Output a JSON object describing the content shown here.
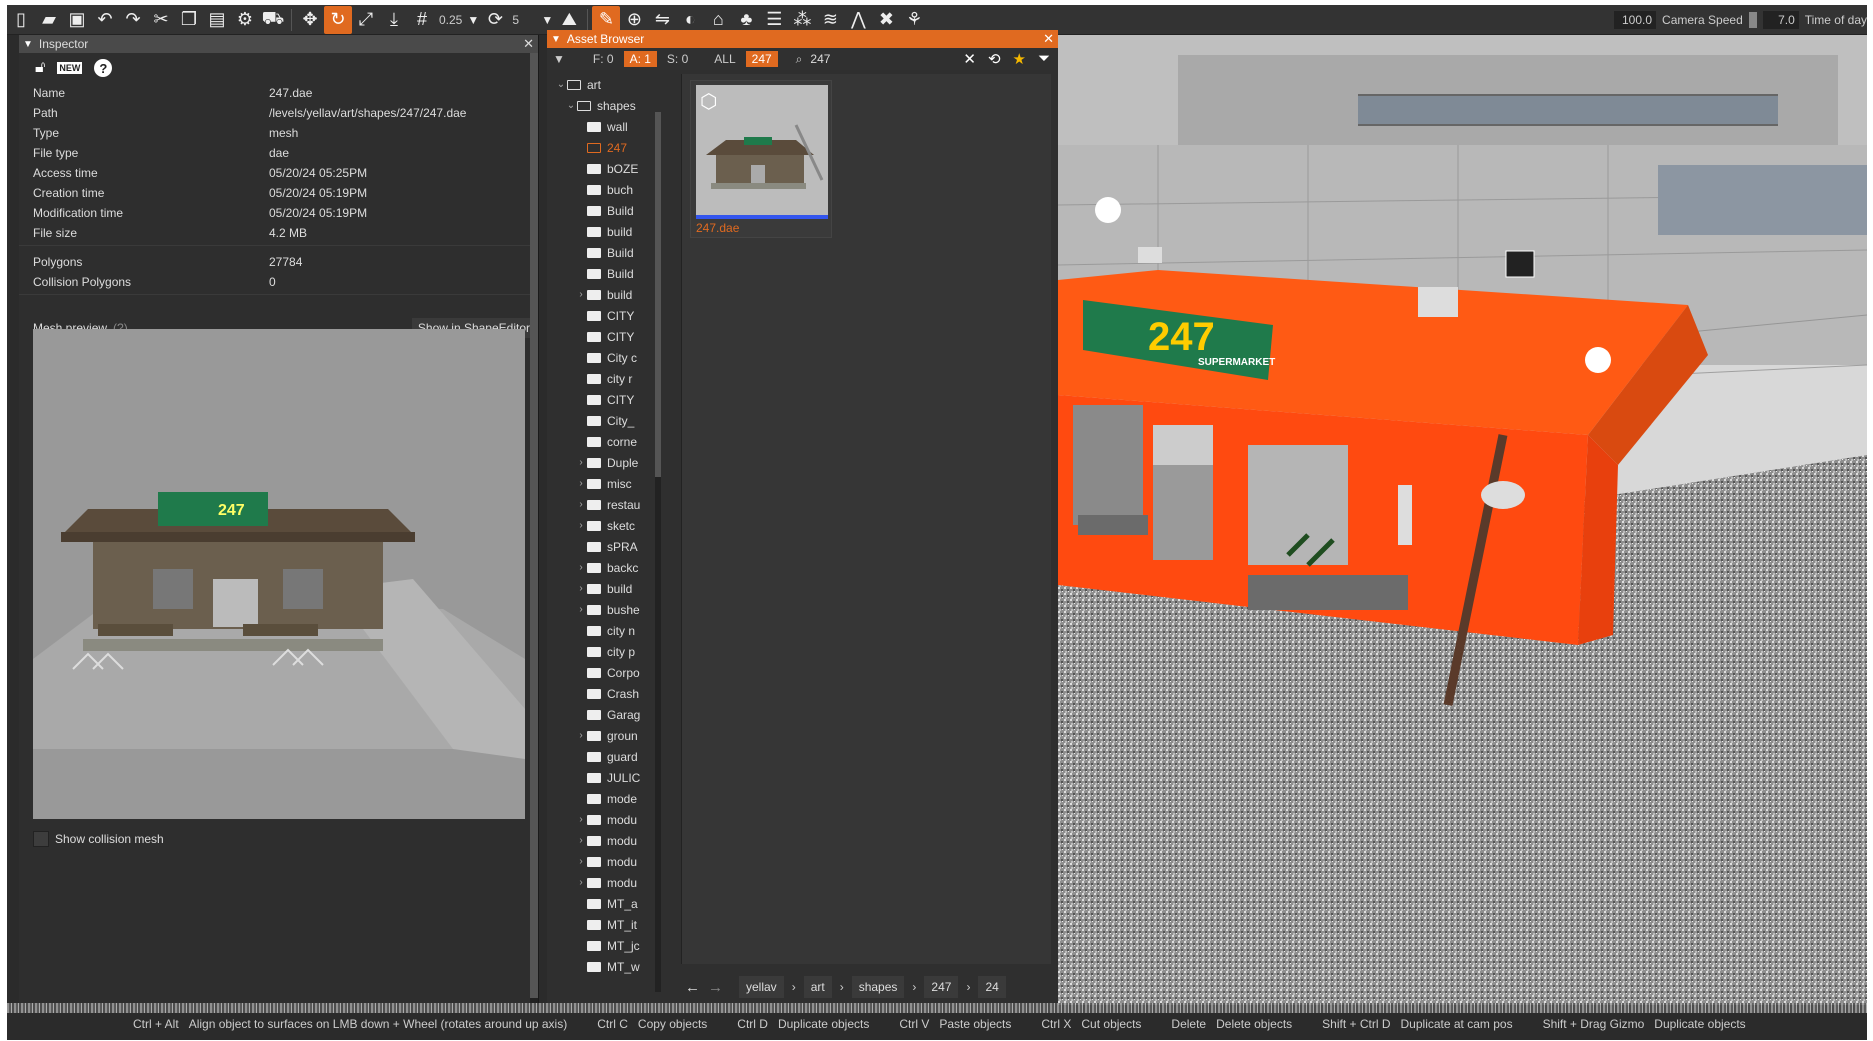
{
  "toolbar": {
    "snap_value": "0.25",
    "rotate_value": "5",
    "camera_speed_value": "100.0",
    "camera_speed_label": "Camera Speed",
    "time_value": "7.0",
    "time_label": "Time of day",
    "active_tool_color": "#e06a20"
  },
  "inspector": {
    "title": "Inspector",
    "tools": [
      "lock-icon",
      "new-icon",
      "help-icon"
    ],
    "new_label": "NEW",
    "props": [
      {
        "k": "Name",
        "v": "247.dae"
      },
      {
        "k": "Path",
        "v": "/levels/yellav/art/shapes/247/247.dae"
      },
      {
        "k": "Type",
        "v": "mesh"
      },
      {
        "k": "File type",
        "v": "dae"
      },
      {
        "k": "Access time",
        "v": "05/20/24 05:25PM"
      },
      {
        "k": "Creation time",
        "v": "05/20/24 05:19PM"
      },
      {
        "k": "Modification time",
        "v": "05/20/24 05:19PM"
      },
      {
        "k": "File size",
        "v": "4.2 MB"
      }
    ],
    "mesh_props": [
      {
        "k": "Polygons",
        "v": "27784"
      },
      {
        "k": "Collision Polygons",
        "v": "0"
      }
    ],
    "mesh_preview_label": "Mesh preview",
    "help_mark": "(?)",
    "show_in_shape_editor": "Show in ShapeEditor",
    "show_collision_mesh": "Show collision mesh"
  },
  "asset_browser": {
    "title": "Asset Browser",
    "filters": {
      "f": "F: 0",
      "a": "A: 1",
      "s": "S: 0",
      "all": "ALL",
      "tag": "247"
    },
    "search_value": "247",
    "tree": [
      {
        "label": "art",
        "indent": 0,
        "arrow": "⌄",
        "fold": "open"
      },
      {
        "label": "shapes",
        "indent": 1,
        "arrow": "⌄",
        "fold": "open"
      },
      {
        "label": "wall",
        "indent": 2,
        "arrow": "",
        "fold": "solid"
      },
      {
        "label": "247",
        "indent": 2,
        "arrow": "",
        "fold": "sel",
        "sel": true
      },
      {
        "label": "bOZE",
        "indent": 2,
        "arrow": "",
        "fold": "solid"
      },
      {
        "label": "buch",
        "indent": 2,
        "arrow": "",
        "fold": "solid"
      },
      {
        "label": "Build",
        "indent": 2,
        "arrow": "",
        "fold": "solid"
      },
      {
        "label": "build",
        "indent": 2,
        "arrow": "",
        "fold": "solid"
      },
      {
        "label": "Build",
        "indent": 2,
        "arrow": "",
        "fold": "solid"
      },
      {
        "label": "Build",
        "indent": 2,
        "arrow": "",
        "fold": "solid"
      },
      {
        "label": "build",
        "indent": 2,
        "arrow": "›",
        "fold": "solid"
      },
      {
        "label": "CITY",
        "indent": 2,
        "arrow": "",
        "fold": "solid"
      },
      {
        "label": "CITY",
        "indent": 2,
        "arrow": "",
        "fold": "solid"
      },
      {
        "label": "City c",
        "indent": 2,
        "arrow": "",
        "fold": "solid"
      },
      {
        "label": "city r",
        "indent": 2,
        "arrow": "",
        "fold": "solid"
      },
      {
        "label": "CITY",
        "indent": 2,
        "arrow": "",
        "fold": "solid"
      },
      {
        "label": "City_",
        "indent": 2,
        "arrow": "",
        "fold": "solid"
      },
      {
        "label": "corne",
        "indent": 2,
        "arrow": "",
        "fold": "solid"
      },
      {
        "label": "Duple",
        "indent": 2,
        "arrow": "›",
        "fold": "solid"
      },
      {
        "label": "misc",
        "indent": 2,
        "arrow": "›",
        "fold": "solid"
      },
      {
        "label": "restau",
        "indent": 2,
        "arrow": "›",
        "fold": "solid"
      },
      {
        "label": "sketc",
        "indent": 2,
        "arrow": "›",
        "fold": "solid"
      },
      {
        "label": "sPRA",
        "indent": 2,
        "arrow": "",
        "fold": "solid"
      },
      {
        "label": "backc",
        "indent": 2,
        "arrow": "›",
        "fold": "solid"
      },
      {
        "label": "build",
        "indent": 2,
        "arrow": "›",
        "fold": "solid"
      },
      {
        "label": "bushe",
        "indent": 2,
        "arrow": "›",
        "fold": "solid"
      },
      {
        "label": "city n",
        "indent": 2,
        "arrow": "",
        "fold": "solid"
      },
      {
        "label": "city p",
        "indent": 2,
        "arrow": "",
        "fold": "solid"
      },
      {
        "label": "Corpo",
        "indent": 2,
        "arrow": "",
        "fold": "solid"
      },
      {
        "label": "Crash",
        "indent": 2,
        "arrow": "",
        "fold": "solid"
      },
      {
        "label": "Garag",
        "indent": 2,
        "arrow": "",
        "fold": "solid"
      },
      {
        "label": "groun",
        "indent": 2,
        "arrow": "›",
        "fold": "solid"
      },
      {
        "label": "guard",
        "indent": 2,
        "arrow": "",
        "fold": "solid"
      },
      {
        "label": "JULIC",
        "indent": 2,
        "arrow": "",
        "fold": "solid"
      },
      {
        "label": "mode",
        "indent": 2,
        "arrow": "",
        "fold": "solid"
      },
      {
        "label": "modu",
        "indent": 2,
        "arrow": "›",
        "fold": "solid"
      },
      {
        "label": "modu",
        "indent": 2,
        "arrow": "›",
        "fold": "solid"
      },
      {
        "label": "modu",
        "indent": 2,
        "arrow": "›",
        "fold": "solid"
      },
      {
        "label": "modu",
        "indent": 2,
        "arrow": "›",
        "fold": "solid"
      },
      {
        "label": "MT_a",
        "indent": 2,
        "arrow": "",
        "fold": "solid"
      },
      {
        "label": "MT_it",
        "indent": 2,
        "arrow": "",
        "fold": "solid"
      },
      {
        "label": "MT_jc",
        "indent": 2,
        "arrow": "",
        "fold": "solid"
      },
      {
        "label": "MT_w",
        "indent": 2,
        "arrow": "",
        "fold": "solid"
      }
    ],
    "tile_label": "247.dae",
    "breadcrumb": [
      "yellav",
      "art",
      "shapes",
      "247",
      "24"
    ]
  },
  "viewport": {
    "sign_text": "247",
    "sign_sub": "SUPERMARKET",
    "roof_color": "#ff5a14",
    "wall_color": "#ff4a10"
  },
  "status": [
    {
      "key": "Ctrl + Alt",
      "desc": "Align object to surfaces on LMB down + Wheel (rotates around up axis)"
    },
    {
      "key": "Ctrl C",
      "desc": "Copy objects"
    },
    {
      "key": "Ctrl D",
      "desc": "Duplicate objects"
    },
    {
      "key": "Ctrl V",
      "desc": "Paste objects"
    },
    {
      "key": "Ctrl X",
      "desc": "Cut objects"
    },
    {
      "key": "Delete",
      "desc": "Delete objects"
    },
    {
      "key": "Shift + Ctrl D",
      "desc": "Duplicate at cam pos"
    },
    {
      "key": "Shift + Drag Gizmo",
      "desc": "Duplicate objects"
    }
  ]
}
